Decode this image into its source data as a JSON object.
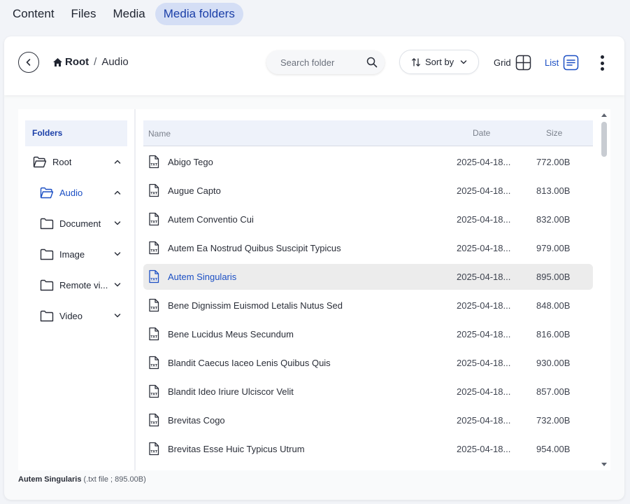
{
  "tabs": [
    {
      "label": "Content",
      "active": false
    },
    {
      "label": "Files",
      "active": false
    },
    {
      "label": "Media",
      "active": false
    },
    {
      "label": "Media folders",
      "active": true
    }
  ],
  "toolbar": {
    "breadcrumb_root": "Root",
    "breadcrumb_sep": "/",
    "breadcrumb_current": "Audio",
    "search_placeholder": "Search folder",
    "sort_label": "Sort by",
    "grid_label": "Grid",
    "list_label": "List"
  },
  "folders": {
    "heading": "Folders",
    "items": [
      {
        "label": "Root",
        "expanded": true,
        "active": false
      },
      {
        "label": "Audio",
        "expanded": true,
        "active": true
      },
      {
        "label": "Document",
        "expanded": false,
        "active": false
      },
      {
        "label": "Image",
        "expanded": false,
        "active": false
      },
      {
        "label": "Remote vi...",
        "expanded": false,
        "active": false
      },
      {
        "label": "Video",
        "expanded": false,
        "active": false
      }
    ]
  },
  "files": {
    "columns": {
      "name": "Name",
      "date": "Date",
      "size": "Size"
    },
    "rows": [
      {
        "name": "Abigo Tego",
        "date": "2025-04-18...",
        "size": "772.00B"
      },
      {
        "name": "Augue Capto",
        "date": "2025-04-18...",
        "size": "813.00B"
      },
      {
        "name": "Autem Conventio Cui",
        "date": "2025-04-18...",
        "size": "832.00B"
      },
      {
        "name": "Autem Ea Nostrud Quibus Suscipit Typicus",
        "date": "2025-04-18...",
        "size": "979.00B"
      },
      {
        "name": "Autem Singularis",
        "date": "2025-04-18...",
        "size": "895.00B",
        "selected": true
      },
      {
        "name": "Bene Dignissim Euismod Letalis Nutus Sed",
        "date": "2025-04-18...",
        "size": "848.00B"
      },
      {
        "name": "Bene Lucidus Meus Secundum",
        "date": "2025-04-18...",
        "size": "816.00B"
      },
      {
        "name": "Blandit Caecus Iaceo Lenis Quibus Quis",
        "date": "2025-04-18...",
        "size": "930.00B"
      },
      {
        "name": "Blandit Ideo Iriure Ulciscor Velit",
        "date": "2025-04-18...",
        "size": "857.00B"
      },
      {
        "name": "Brevitas Cogo",
        "date": "2025-04-18...",
        "size": "732.00B"
      },
      {
        "name": "Brevitas Esse Huic Typicus Utrum",
        "date": "2025-04-18...",
        "size": "954.00B"
      }
    ],
    "file_icon": "txt-file-icon"
  },
  "status": {
    "name": "Autem Singularis",
    "detail": "(.txt file ; 895.00B)"
  },
  "colors": {
    "accent": "#1b4fc4",
    "tab_active_bg": "#d4def5",
    "header_bg": "#eef2fa",
    "selected_row_bg": "#ececec"
  }
}
